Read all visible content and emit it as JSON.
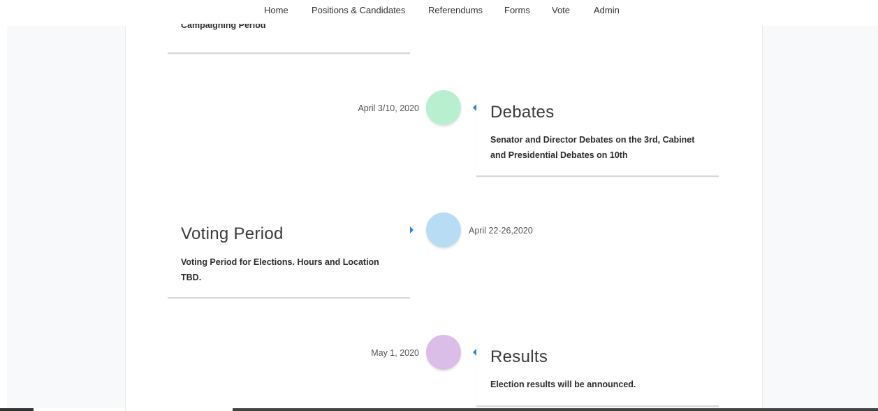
{
  "nav": {
    "items": [
      "Home",
      "Positions & Candidates",
      "Referendums",
      "Forms",
      "Vote",
      "Admin"
    ]
  },
  "timeline": {
    "campaigning": {
      "text": "Campaigning Period"
    },
    "debates": {
      "date": "April 3/10, 2020",
      "title": "Debates",
      "text": "Senator and Director Debates on the 3rd, Cabinet and Presidential Debates on 10th",
      "dot_color": "#b8efcf"
    },
    "voting": {
      "date": "April 22-26,2020",
      "title": "Voting Period",
      "text": "Voting Period for Elections. Hours and Location TBD.",
      "dot_color": "#b9dcf5"
    },
    "results": {
      "date": "May 1, 2020",
      "title": "Results",
      "text": "Election results will be announced.",
      "dot_color": "#dcbde8"
    }
  },
  "colors": {
    "arrow": "#1e88e5"
  }
}
